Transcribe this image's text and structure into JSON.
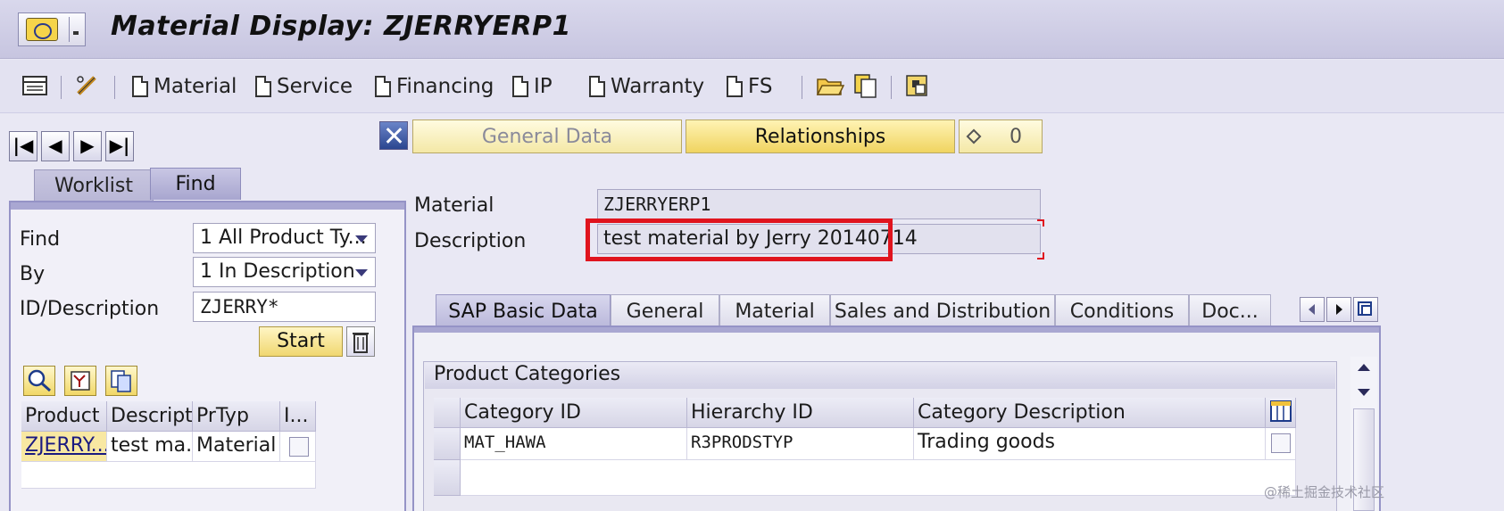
{
  "window": {
    "title": "Material Display: ZJERRYERP1"
  },
  "toolbar": {
    "buttons": [
      {
        "label": "Material",
        "icon": "document-icon"
      },
      {
        "label": "Service",
        "icon": "document-icon"
      },
      {
        "label": "Financing",
        "icon": "document-icon"
      },
      {
        "label": "IP",
        "icon": "document-icon"
      },
      {
        "label": "Warranty",
        "icon": "document-icon"
      },
      {
        "label": "FS",
        "icon": "document-icon"
      }
    ]
  },
  "left": {
    "tabs": [
      "Worklist",
      "Find"
    ],
    "active_tab": "Find",
    "find": {
      "find_label": "Find",
      "find_value": "1 All Product Ty...",
      "by_label": "By",
      "by_value": "1 In Description",
      "id_label": "ID/Description",
      "id_value": "ZJERRY*",
      "start_label": "Start"
    },
    "results": {
      "columns": [
        "Product",
        "Descriptn",
        "PrTyp",
        "I..."
      ],
      "rows": [
        {
          "product": "ZJERRY...",
          "desc": "test ma...",
          "type": "Material"
        }
      ]
    }
  },
  "header_buttons": {
    "general": "General Data",
    "relationships": "Relationships",
    "count": "0"
  },
  "material": {
    "material_label": "Material",
    "material_value": "ZJERRYERP1",
    "description_label": "Description",
    "description_value": "test material by Jerry 20140714"
  },
  "tabstrip": {
    "tabs": [
      "SAP Basic Data",
      "General",
      "Material",
      "Sales and Distribution",
      "Conditions",
      "Doc..."
    ],
    "active": "SAP Basic Data"
  },
  "categories": {
    "title": "Product Categories",
    "columns": [
      "Category ID",
      "Hierarchy ID",
      "Category Description"
    ],
    "rows": [
      {
        "category_id": "MAT_HAWA",
        "hierarchy_id": "R3PRODSTYP",
        "description": "Trading goods"
      }
    ]
  },
  "watermark": "@稀土掘金技术社区",
  "colors": {
    "highlight": "#e0141e",
    "panel_border": "#9593c6",
    "button_yellow": "#f0d460"
  }
}
